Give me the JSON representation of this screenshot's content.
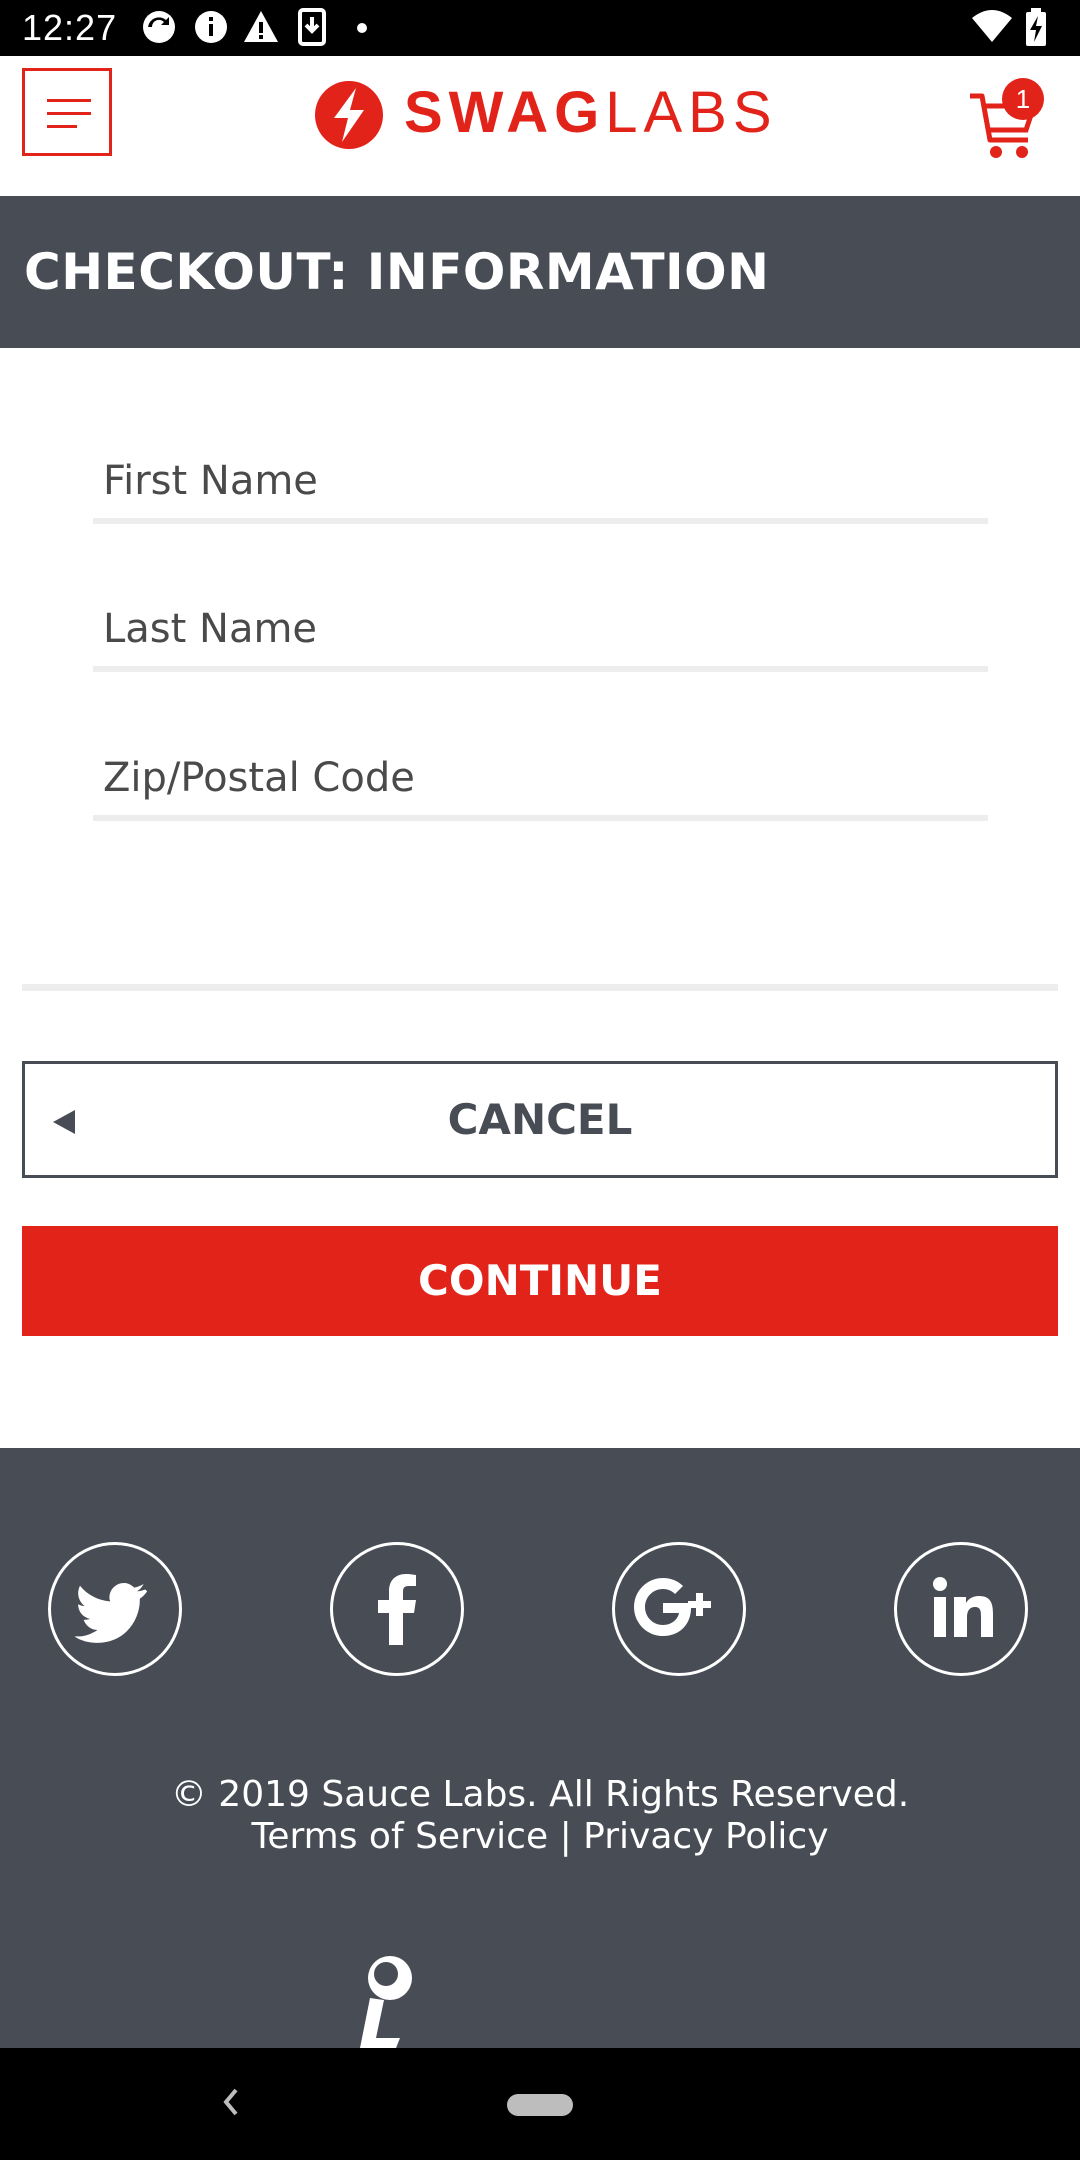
{
  "status_bar": {
    "time": "12:27"
  },
  "header": {
    "logo_bold": "SWAG",
    "logo_light": "LABS",
    "cart_count": "1",
    "brand_color": "#e2231a"
  },
  "page": {
    "title": "CHECKOUT: INFORMATION"
  },
  "form": {
    "first_name": {
      "placeholder": "First Name",
      "value": ""
    },
    "last_name": {
      "placeholder": "Last Name",
      "value": ""
    },
    "zip": {
      "placeholder": "Zip/Postal Code",
      "value": ""
    }
  },
  "actions": {
    "cancel_label": "CANCEL",
    "continue_label": "CONTINUE"
  },
  "footer": {
    "social": [
      "twitter-icon",
      "facebook-icon",
      "google-plus-icon",
      "linkedin-icon"
    ],
    "copyright": "© 2019 Sauce Labs. All Rights Reserved.",
    "terms": "Terms of Service",
    "separator": "|",
    "privacy": "Privacy Policy",
    "background": "#474c55"
  }
}
